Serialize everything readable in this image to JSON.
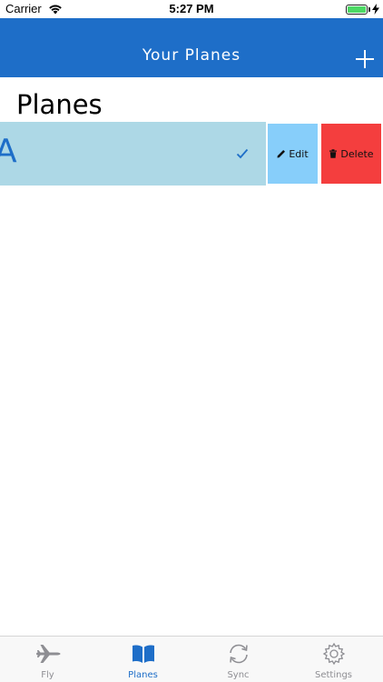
{
  "status_bar": {
    "carrier": "Carrier",
    "time": "5:27 PM",
    "battery_level": 1.0
  },
  "nav": {
    "title": "Your Planes",
    "add_icon": "plus-icon"
  },
  "section": {
    "title": "Planes"
  },
  "planes": [
    {
      "name": "A",
      "selected": true
    }
  ],
  "row_actions": {
    "edit_label": "Edit",
    "delete_label": "Delete"
  },
  "tabs": [
    {
      "label": "Fly",
      "icon": "airplane-icon",
      "active": false
    },
    {
      "label": "Planes",
      "icon": "book-icon",
      "active": true
    },
    {
      "label": "Sync",
      "icon": "sync-icon",
      "active": false
    },
    {
      "label": "Settings",
      "icon": "gear-icon",
      "active": false
    }
  ],
  "colors": {
    "primary": "#1e6ec8",
    "row_bg": "#add8e6",
    "edit_bg": "#87cefa",
    "delete_bg": "#f43e3e",
    "tab_inactive": "#8e8e93"
  }
}
